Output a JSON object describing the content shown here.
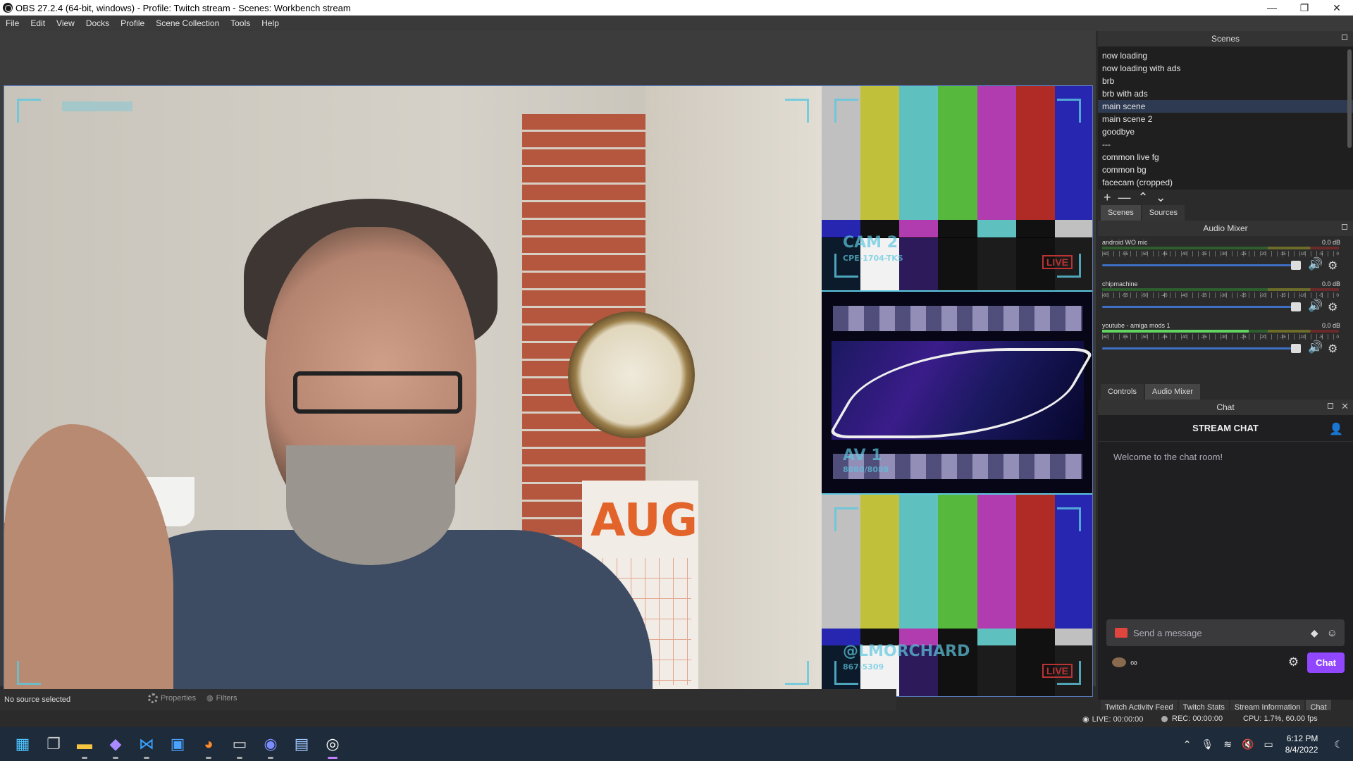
{
  "window": {
    "title": "OBS 27.2.4 (64-bit, windows) - Profile: Twitch stream - Scenes: Workbench stream",
    "min": "—",
    "max": "❐",
    "close": "✕"
  },
  "menu": [
    "File",
    "Edit",
    "View",
    "Docks",
    "Profile",
    "Scene Collection",
    "Tools",
    "Help"
  ],
  "preview": {
    "cam2_label": "CAM 2",
    "cam2_sub": "CPE-1704-TKS",
    "live_tag": "LIVE",
    "av_label": "AV 1",
    "av_sub": "8080/8088",
    "handle_label": "@LMORCHARD",
    "handle_sub": "867-5309",
    "live_tag2": "LIVE",
    "calendar_month": "AUG"
  },
  "source_bar": {
    "no_source": "No source selected",
    "properties": "Properties",
    "filters": "Filters"
  },
  "scenes": {
    "title": "Scenes",
    "items": [
      "now loading",
      "now loading with ads",
      "brb",
      "brb with ads",
      "main scene",
      "main scene 2",
      "goodbye",
      "---",
      "common live fg",
      "common bg",
      "facecam (cropped)"
    ],
    "selected_index": 4,
    "controls": {
      "add": "+",
      "remove": "—",
      "up": "⌃",
      "down": "⌄"
    },
    "tabs": [
      "Scenes",
      "Sources"
    ]
  },
  "mixer": {
    "title": "Audio Mixer",
    "tick_labels": [
      "-60",
      "-55",
      "-50",
      "-45",
      "-40",
      "-35",
      "-30",
      "-25",
      "-20",
      "-15",
      "-10",
      "-5",
      "0"
    ],
    "channels": [
      {
        "name": "android WO mic",
        "db": "0.0 dB",
        "level": 0.0,
        "volume": 1.0
      },
      {
        "name": "chipmachine",
        "db": "0.0 dB",
        "level": 0.0,
        "volume": 1.0
      },
      {
        "name": "youtube - amiga mods 1",
        "db": "0.0 dB",
        "level": 0.62,
        "volume": 1.0
      }
    ],
    "tabs": [
      "Controls",
      "Audio Mixer"
    ]
  },
  "chat": {
    "dock_title": "Chat",
    "header": "STREAM CHAT",
    "welcome": "Welcome to the chat room!",
    "input_placeholder": "Send a message",
    "points": "∞",
    "chat_button": "Chat"
  },
  "bottom_tabs": [
    "Twitch Activity Feed",
    "Twitch Stats",
    "Stream Information",
    "Chat"
  ],
  "status": {
    "live": "LIVE: 00:00:00",
    "rec": "REC: 00:00:00",
    "cpu": "CPU: 1.7%, 60.00 fps"
  },
  "taskbar": {
    "time": "6:12 PM",
    "date": "8/4/2022"
  },
  "colors": {
    "accent": "#9147ff",
    "selected_scene": "#2d3a52",
    "preview_border": "#5a7ab8"
  }
}
